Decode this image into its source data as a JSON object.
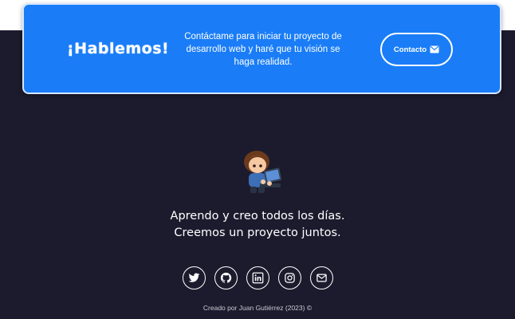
{
  "cta": {
    "title": "¡Hablemos!",
    "text": "Contáctame para iniciar tu proyecto de desarrollo web y haré que tu visión se haga realidad.",
    "button_label": "Contacto",
    "button_icon": "mail-send-icon",
    "color": "#1a7df7"
  },
  "footer": {
    "tagline_line1": "Aprendo y creo todos los días.",
    "tagline_line2": "Creemos un proyecto juntos.",
    "socials": [
      {
        "name": "twitter",
        "icon": "twitter-icon"
      },
      {
        "name": "github",
        "icon": "github-icon"
      },
      {
        "name": "linkedin",
        "icon": "linkedin-icon"
      },
      {
        "name": "instagram",
        "icon": "instagram-icon"
      },
      {
        "name": "email",
        "icon": "envelope-icon"
      }
    ],
    "credit": "Creado por Juan Gutiérrez (2023) ©",
    "background": "#1c1b2e"
  }
}
